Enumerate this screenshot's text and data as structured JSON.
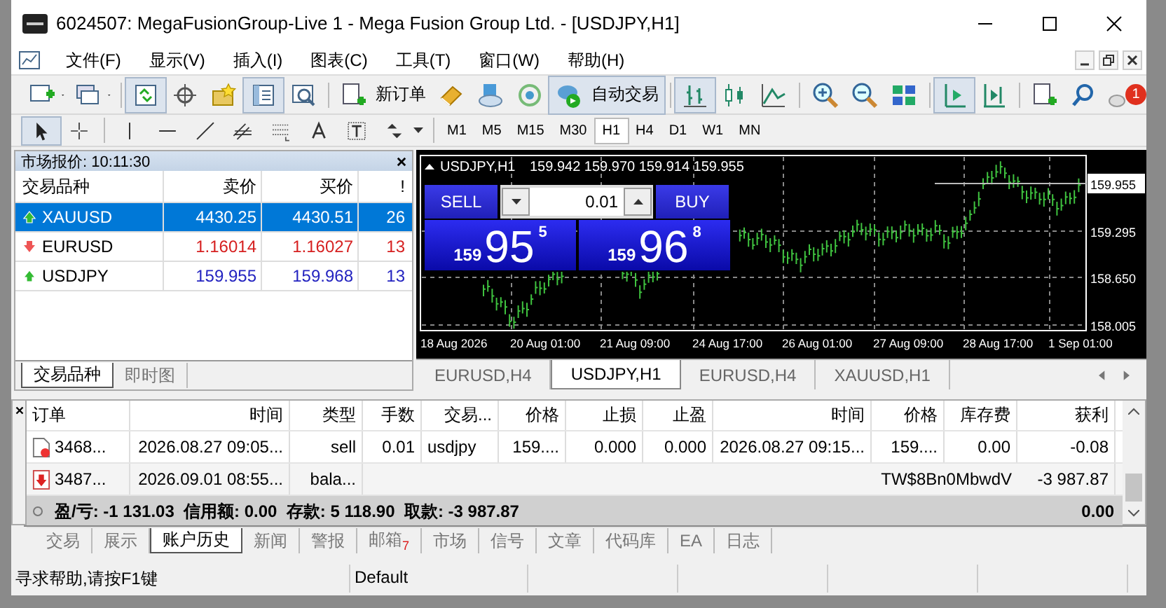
{
  "window": {
    "title": "6024507: MegaFusionGroup-Live 1 - Mega Fusion Group Ltd. - [USDJPY,H1]"
  },
  "menu": [
    "文件(F)",
    "显示(V)",
    "插入(I)",
    "图表(C)",
    "工具(T)",
    "窗口(W)",
    "帮助(H)"
  ],
  "toolbar": {
    "new_order": "新订单",
    "auto_trading": "自动交易",
    "notifications": "1"
  },
  "timeframes": [
    {
      "label": "M1",
      "selected": false
    },
    {
      "label": "M5",
      "selected": false
    },
    {
      "label": "M15",
      "selected": false
    },
    {
      "label": "M30",
      "selected": false
    },
    {
      "label": "H1",
      "selected": true
    },
    {
      "label": "H4",
      "selected": false
    },
    {
      "label": "D1",
      "selected": false
    },
    {
      "label": "W1",
      "selected": false
    },
    {
      "label": "MN",
      "selected": false
    }
  ],
  "market_watch": {
    "title": "市场报价: 10:11:30",
    "columns": [
      "交易品种",
      "卖价",
      "买价",
      "!"
    ],
    "rows": [
      {
        "symbol": "XAUUSD",
        "bid": "4430.25",
        "ask": "4430.51",
        "spread": "26",
        "rising": true,
        "selected": true
      },
      {
        "symbol": "EURUSD",
        "bid": "1.16014",
        "ask": "1.16027",
        "spread": "13",
        "rising": false,
        "selected": false
      },
      {
        "symbol": "USDJPY",
        "bid": "159.955",
        "ask": "159.968",
        "spread": "13",
        "rising": true,
        "selected": false
      }
    ],
    "tabs": [
      {
        "label": "交易品种",
        "selected": true
      },
      {
        "label": "即时图",
        "selected": false
      }
    ]
  },
  "chart": {
    "symbol": "USDJPY,H1",
    "ohlc": "159.942 159.970 159.914 159.955",
    "sell": "SELL",
    "buy": "BUY",
    "lot": "0.01",
    "sell_price": {
      "prefix": "159",
      "main": "95",
      "suffix": "5"
    },
    "buy_price": {
      "prefix": "159",
      "main": "96",
      "suffix": "8"
    },
    "current_price": "159.955",
    "price_labels": [
      "159.295",
      "158.650",
      "158.005"
    ],
    "time_labels": [
      "18 Aug 2026",
      "20 Aug 01:00",
      "21 Aug 09:00",
      "24 Aug 17:00",
      "26 Aug 01:00",
      "27 Aug 09:00",
      "28 Aug 17:00",
      "1 Sep 01:00"
    ]
  },
  "chart_tabs": [
    {
      "label": "EURUSD,H4",
      "selected": false
    },
    {
      "label": "USDJPY,H1",
      "selected": true
    },
    {
      "label": "EURUSD,H4",
      "selected": false
    },
    {
      "label": "XAUUSD,H1",
      "selected": false
    }
  ],
  "terminal": {
    "columns": [
      "订单",
      "时间",
      "类型",
      "手数",
      "交易...",
      "价格",
      "止损",
      "止盈",
      "时间",
      "价格",
      "库存费",
      "获利"
    ],
    "rows": [
      {
        "kind": "order",
        "cells": [
          "3468...",
          "2026.08.27 09:05...",
          "sell",
          "0.01",
          "usdjpy",
          "159....",
          "0.000",
          "0.000",
          "2026.08.27 09:15...",
          "159....",
          "0.00",
          "-0.08"
        ]
      },
      {
        "kind": "balance",
        "cells": [
          "3487...",
          "2026.09.01 08:55...",
          "bala...",
          "",
          "",
          "",
          "",
          "",
          "",
          "",
          "TW$8Bn0MbwdV",
          "-3 987.87"
        ]
      }
    ],
    "summary": "盈/亏: -1 131.03  信用额: 0.00  存款: 5 118.90  取款: -3 987.87",
    "summary_total": "0.00",
    "tabs": [
      {
        "label": "交易",
        "selected": false
      },
      {
        "label": "展示",
        "selected": false
      },
      {
        "label": "账户历史",
        "selected": true
      },
      {
        "label": "新闻",
        "selected": false
      },
      {
        "label": "警报",
        "selected": false
      },
      {
        "label": "邮箱",
        "selected": false,
        "badge": "7"
      },
      {
        "label": "市场",
        "selected": false
      },
      {
        "label": "信号",
        "selected": false
      },
      {
        "label": "文章",
        "selected": false
      },
      {
        "label": "代码库",
        "selected": false
      },
      {
        "label": "EA",
        "selected": false
      },
      {
        "label": "日志",
        "selected": false
      }
    ]
  },
  "status_bar": [
    "寻求帮助,请按F1键",
    "Default"
  ]
}
